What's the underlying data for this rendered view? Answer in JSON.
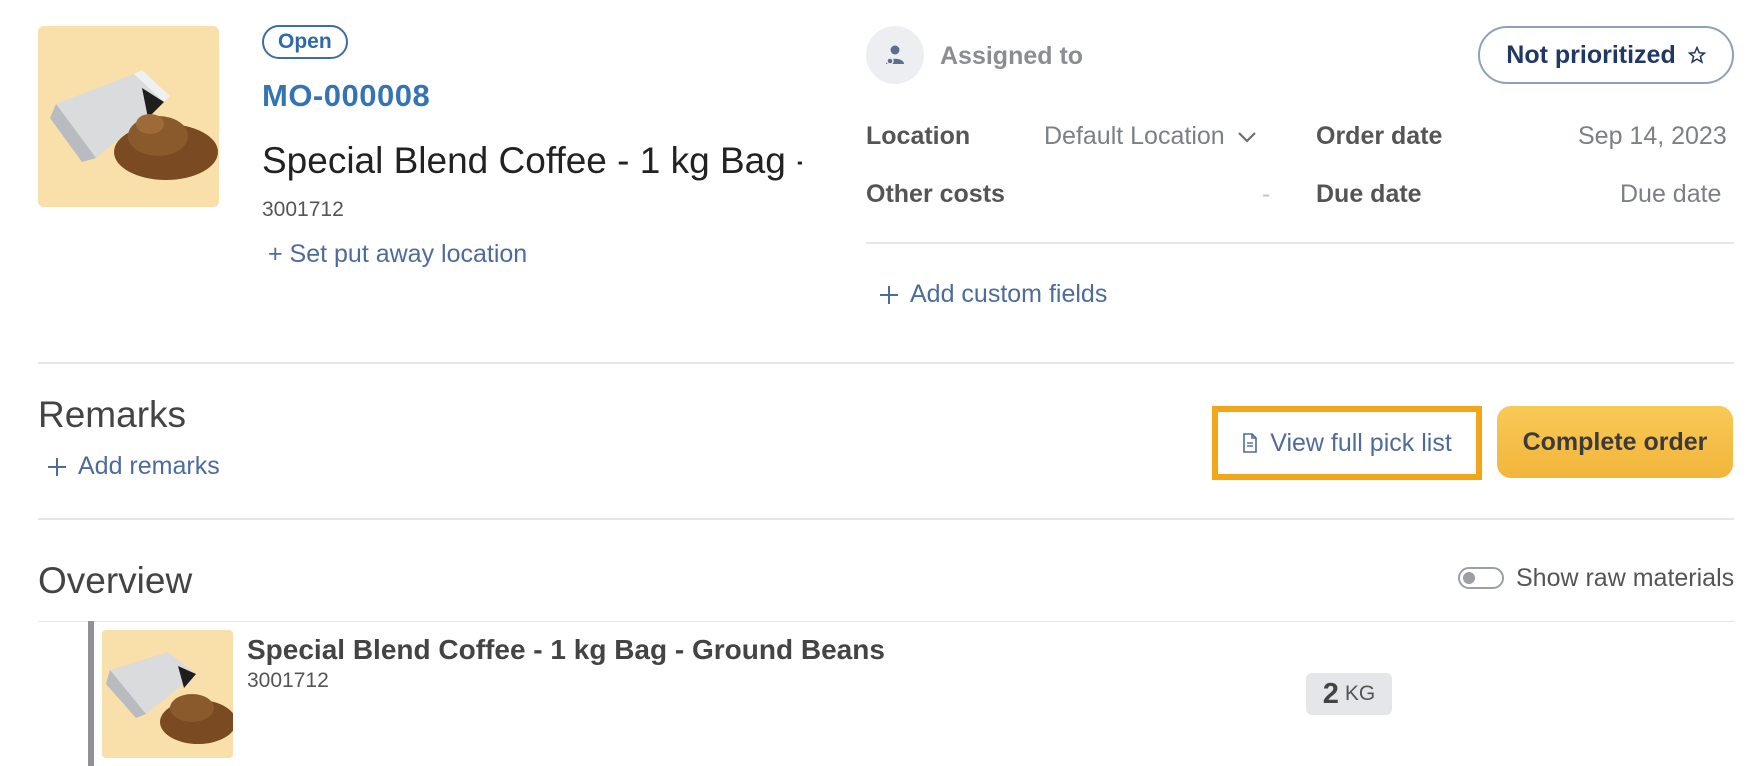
{
  "order": {
    "status": "Open",
    "id": "MO-000008",
    "product_name": "Special Blend Coffee - 1 kg Bag - …",
    "sku": "3001712",
    "put_away_label": "+ Set put away location"
  },
  "assignment": {
    "label": "Assigned to",
    "avatar_icon": "user-icon"
  },
  "priority": {
    "label": "Not prioritized",
    "icon": "star-outline-icon"
  },
  "fields": {
    "location_label": "Location",
    "location_value": "Default Location",
    "other_costs_label": "Other costs",
    "other_costs_value": "-",
    "order_date_label": "Order date",
    "order_date_value": "Sep 14, 2023",
    "due_date_label": "Due date",
    "due_date_value": "Due date",
    "add_custom_label": "Add custom fields"
  },
  "remarks": {
    "title": "Remarks",
    "add_label": "Add remarks"
  },
  "actions": {
    "pick_list_label": "View full pick list",
    "complete_label": "Complete order",
    "highlight_color": "#f2a71b",
    "complete_color": "#f4bb45"
  },
  "overview": {
    "title": "Overview",
    "toggle_label": "Show raw materials",
    "toggle_on": false,
    "item": {
      "name": "Special Blend Coffee - 1 kg Bag - Ground Beans",
      "sku": "3001712",
      "quantity": "2",
      "unit": "KG"
    }
  }
}
